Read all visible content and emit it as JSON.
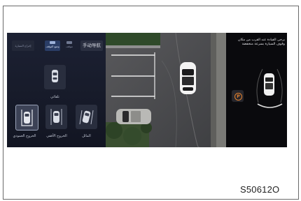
{
  "figure_code": "S50612O",
  "left_panel": {
    "tabs": [
      {
        "label": "إخراج السيارة",
        "icon": "",
        "selected": false
      },
      {
        "label": "وضع التوقف",
        "icon": "parking-car-icon",
        "selected": true
      },
      {
        "label": "موقف",
        "icon": "garage-icon",
        "selected": false
      },
      {
        "label": "手动导航",
        "icon": "",
        "selected": false
      }
    ],
    "modes": [
      {
        "label": "تلقائي",
        "icon": "auto-park-car-icon",
        "selected": false
      },
      {
        "label": "الخروج العمودي",
        "icon": "vertical-exit-icon",
        "selected": true
      },
      {
        "label": "الخروج الأفقي",
        "icon": "horizontal-exit-icon",
        "selected": false
      },
      {
        "label": "المائل",
        "icon": "diagonal-exit-icon",
        "selected": false
      }
    ]
  },
  "right_panel": {
    "hint_text": "يرجى القيادة عند القرب من مكان وقوف السيارة بسرعة منخفضة",
    "parking_badge": "P"
  },
  "colors": {
    "accent_orange": "#e3802c",
    "selected_tab": "#2a3d66",
    "panel_bg": "#1c2133"
  }
}
